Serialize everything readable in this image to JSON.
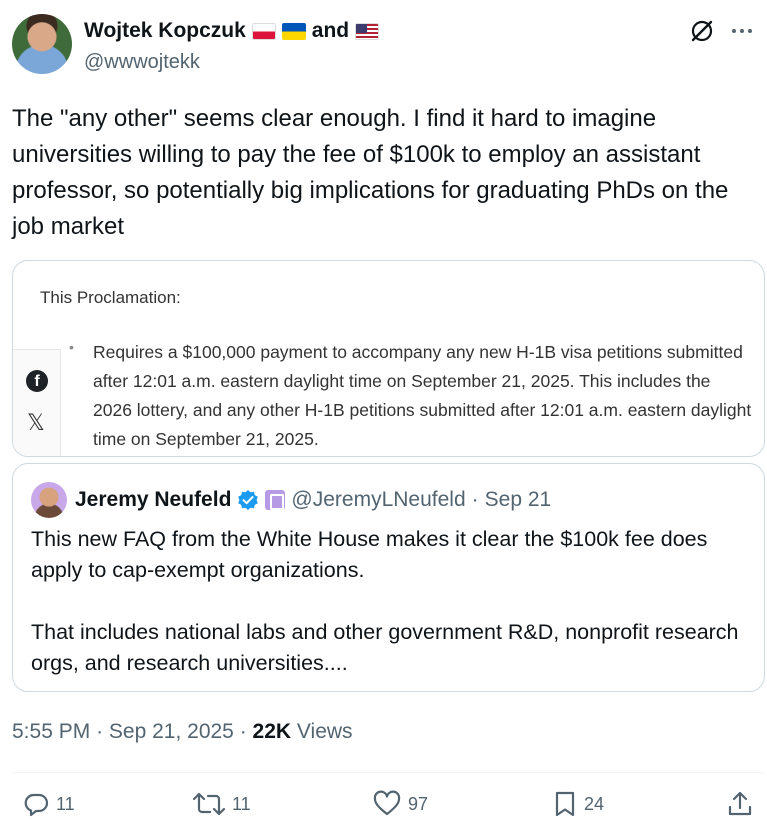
{
  "author": {
    "name": "Wojtek Kopczuk",
    "flags": [
      "poland-flag-icon",
      "ukraine-flag-icon",
      "usa-flag-icon"
    ],
    "and_word": "and",
    "handle": "@wwwojtekk"
  },
  "tweet": {
    "text": "The \"any other\" seems clear enough. I find it hard to imagine universities willing to pay the fee of $100k to employ an assistant professor, so potentially big implications for graduating PhDs on the job market"
  },
  "card": {
    "heading": "This Proclamation:",
    "bullet": "•",
    "body": "Requires a $100,000 payment to accompany any new H-1B visa petitions submitted after 12:01 a.m. eastern daylight time on September 21, 2025. This includes the 2026 lottery, and any other H-1B petitions submitted after 12:01 a.m. eastern daylight time on September 21, 2025.",
    "share_icons": [
      "facebook-icon",
      "x-logo-icon"
    ],
    "fb_glyph": "f",
    "x_glyph": "𝕏"
  },
  "quote": {
    "name": "Jeremy Neufeld",
    "handle": "@JeremyLNeufeld",
    "separator": "·",
    "date": "Sep 21",
    "text": "This new FAQ from the White House makes it clear the $100k fee does apply to cap-exempt organizations.\n\nThat includes national labs and other government R&D, nonprofit research orgs, and research universities...."
  },
  "meta": {
    "time": "5:55 PM",
    "sep1": "·",
    "date": "Sep 21, 2025",
    "sep2": "·",
    "views_count": "22K",
    "views_label": "Views"
  },
  "actions": {
    "replies": "11",
    "reposts": "11",
    "likes": "97",
    "bookmarks": "24"
  },
  "colors": {
    "text": "#0f1419",
    "secondary": "#536471",
    "verified": "#1d9bf0",
    "border": "#cfd9de"
  }
}
